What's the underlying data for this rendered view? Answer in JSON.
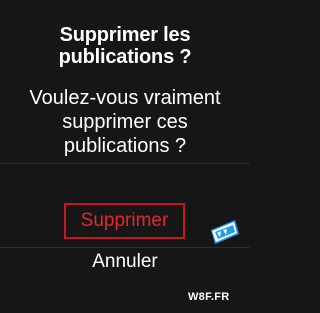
{
  "dialog": {
    "title": "Supprimer les publications ?",
    "message": "Voulez-vous vraiment supprimer ces publications ?",
    "confirm_label": "Supprimer",
    "cancel_label": "Annuler"
  },
  "watermark": {
    "text": "W8F.FR",
    "icon": "w8f-logo-icon"
  },
  "colors": {
    "background": "#161616",
    "text": "#ffffff",
    "danger": "#e5262c",
    "danger_border": "#c8161d",
    "logo_blue": "#1e9be9"
  }
}
